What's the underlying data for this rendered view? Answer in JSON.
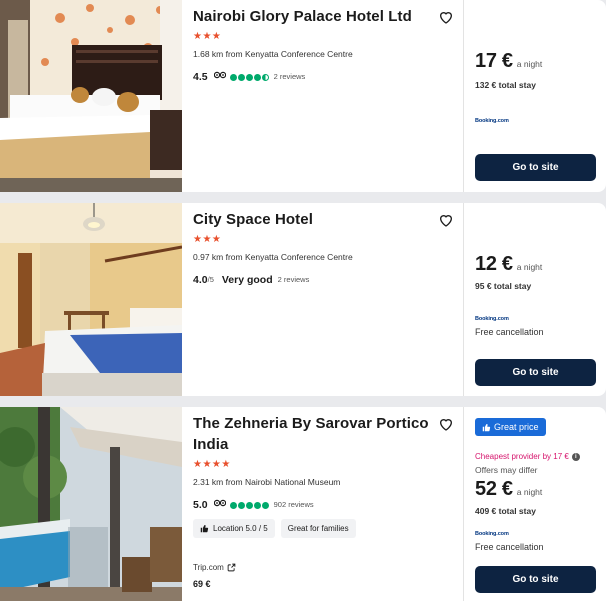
{
  "hotels": [
    {
      "name": "Nairobi Glory Palace Hotel Ltd",
      "stars": "★★★",
      "distance": "1.68 km from Kenyatta Conference Centre",
      "rating": "4.5",
      "reviews": "2 reviews",
      "price": "17 €",
      "per_night": "a night",
      "total": "132 € total stay",
      "provider": "Booking.com",
      "cta": "Go to site"
    },
    {
      "name": "City Space Hotel",
      "stars": "★★★",
      "distance": "0.97 km from Kenyatta Conference Centre",
      "rating": "4.0",
      "rating_scale": "/5",
      "rating_text": "Very good",
      "reviews": "2 reviews",
      "price": "12 €",
      "per_night": "a night",
      "total": "95 € total stay",
      "provider": "Booking.com",
      "cancellation": "Free cancellation",
      "cta": "Go to site"
    },
    {
      "name": "The Zehneria By Sarovar Portico India",
      "stars": "★★★★",
      "distance": "2.31 km from Nairobi National Museum",
      "rating": "5.0",
      "reviews": "902 reviews",
      "chip_location": "Location 5.0 / 5",
      "chip_families": "Great for families",
      "partner_name": "Trip.com",
      "partner_price": "69 €",
      "badge": "Great price",
      "cheapest": "Cheapest provider by 17 €",
      "offers_differ": "Offers may differ",
      "price": "52 €",
      "per_night": "a night",
      "total": "409 € total stay",
      "provider": "Booking.com",
      "cancellation": "Free cancellation",
      "cta": "Go to site"
    }
  ],
  "icons": {
    "favorite": "heart-outline-icon",
    "tripadvisor": "owl-icon",
    "thumbs_up": "thumbs-up-icon",
    "external": "external-link-icon",
    "info": "info-icon"
  },
  "colors": {
    "button": "#0d2341",
    "stars": "#e8502d",
    "rating_dots": "#00aa6c",
    "badge": "#1a6bd8",
    "cheapest": "#d6156d"
  }
}
